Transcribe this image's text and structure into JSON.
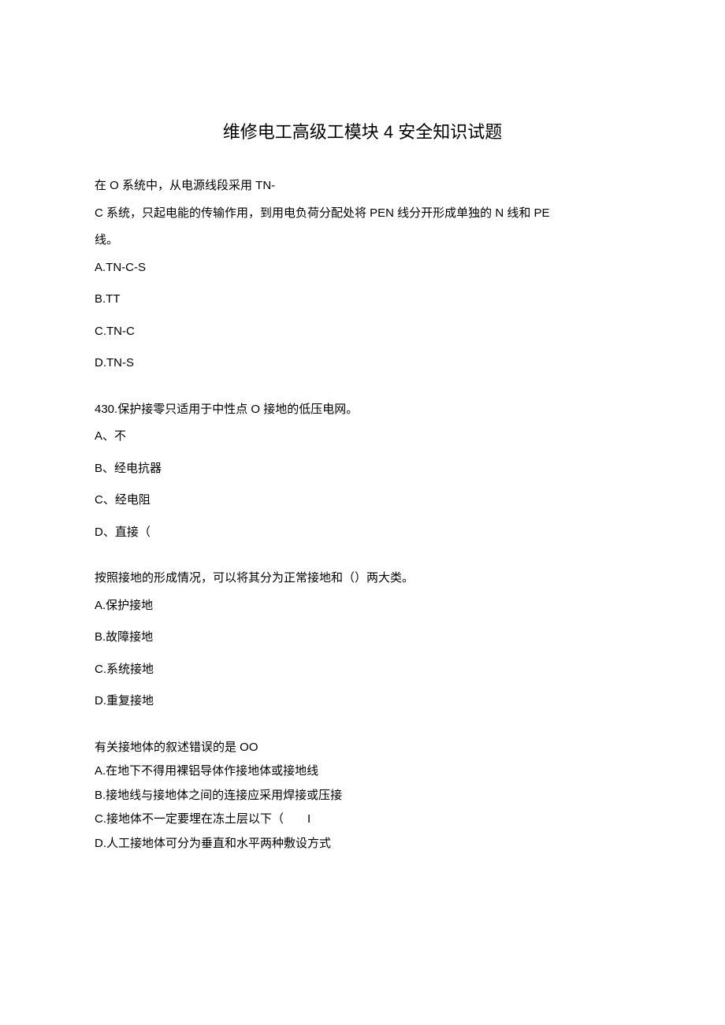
{
  "title": "维修电工高级工模块 4 安全知识试题",
  "q1": {
    "line1": "在 O 系统中，从电源线段采用 TN-",
    "line2": "C 系统，只起电能的传输作用，到用电负荷分配处将 PEN 线分开形成单独的 N 线和 PE",
    "line3": "线。",
    "optA": "A.TN-C-S",
    "optB": "B.TT",
    "optC": "C.TN-C",
    "optD": "D.TN-S"
  },
  "q2": {
    "text": "430.保护接零只适用于中性点 O 接地的低压电网。",
    "optA": "A、不",
    "optB": "B、经电抗器",
    "optC": "C、经电阻",
    "optD": "D、直接（"
  },
  "q3": {
    "text": "按照接地的形成情况，可以将其分为正常接地和（）两大类。",
    "optA": "A.保护接地",
    "optB": "B.故障接地",
    "optC": "C.系统接地",
    "optD": "D.重复接地"
  },
  "q4": {
    "text": "有关接地体的叙述错误的是 OO",
    "optA": "A.在地下不得用裸铝导体作接地体或接地线",
    "optB": "B.接地线与接地体之间的连接应采用焊接或压接",
    "optC": "C.接地体不一定要埋在冻土层以下（  I",
    "optD": "D.人工接地体可分为垂直和水平两种敷设方式"
  }
}
